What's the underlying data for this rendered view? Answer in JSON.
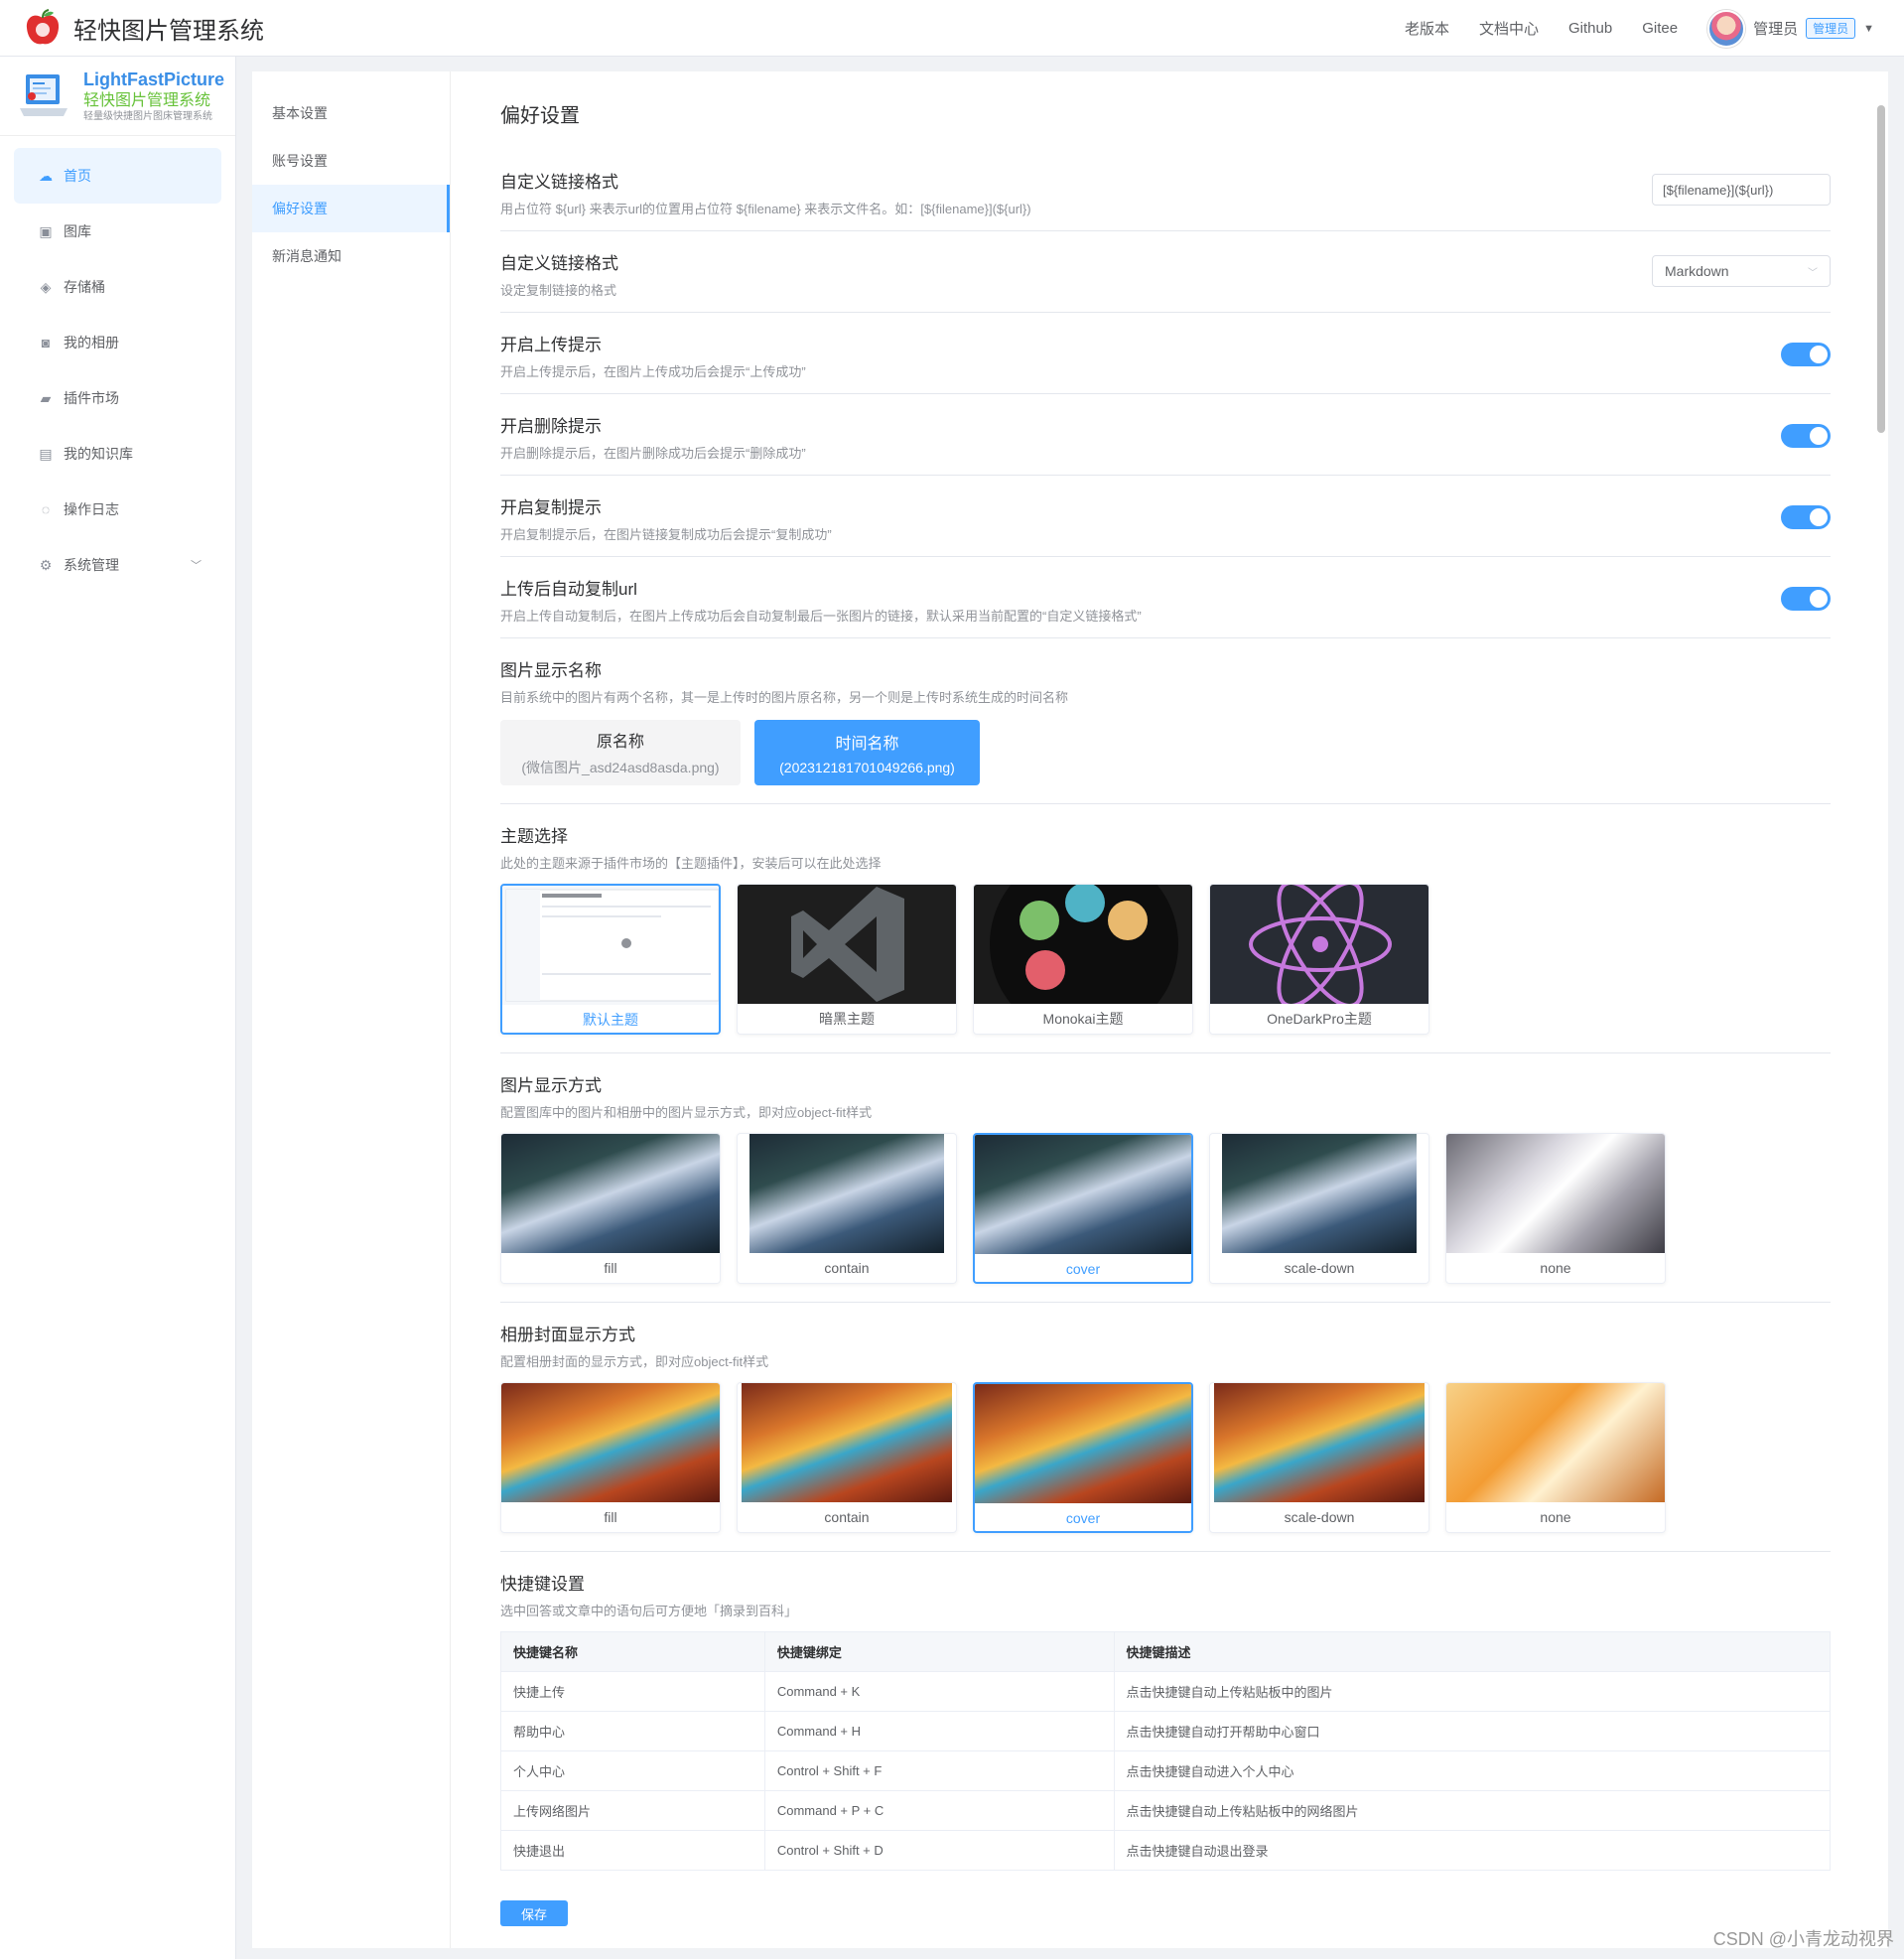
{
  "app": {
    "title": "轻快图片管理系统"
  },
  "topnav": {
    "links": [
      "老版本",
      "文档中心",
      "Github",
      "Gitee"
    ],
    "user_name": "管理员",
    "role": "管理员"
  },
  "sidebar": {
    "logo_en": "LightFastPicture",
    "logo_cn": "轻快图片管理系统",
    "logo_sub": "轻量级快捷图片图床管理系统",
    "items": [
      {
        "label": "首页",
        "icon": "cloud-icon"
      },
      {
        "label": "图库",
        "icon": "image-icon"
      },
      {
        "label": "存储桶",
        "icon": "bucket-icon"
      },
      {
        "label": "我的相册",
        "icon": "camera-icon"
      },
      {
        "label": "插件市场",
        "icon": "plugin-icon"
      },
      {
        "label": "我的知识库",
        "icon": "book-icon"
      },
      {
        "label": "操作日志",
        "icon": "chat-icon"
      },
      {
        "label": "系统管理",
        "icon": "gear-icon"
      }
    ]
  },
  "subnav": {
    "items": [
      "基本设置",
      "账号设置",
      "偏好设置",
      "新消息通知"
    ]
  },
  "page": {
    "title": "偏好设置"
  },
  "settings": {
    "link_format": {
      "title": "自定义链接格式",
      "desc": "用占位符 ${url} 来表示url的位置用占位符 ${filename} 来表示文件名。如：[${filename}](${url})",
      "value": "[${filename}](${url})"
    },
    "copy_format": {
      "title": "自定义链接格式",
      "desc": "设定复制链接的格式",
      "value": "Markdown"
    },
    "upload_tip": {
      "title": "开启上传提示",
      "desc": "开启上传提示后，在图片上传成功后会提示“上传成功”"
    },
    "delete_tip": {
      "title": "开启删除提示",
      "desc": "开启删除提示后，在图片删除成功后会提示“删除成功”"
    },
    "copy_tip": {
      "title": "开启复制提示",
      "desc": "开启复制提示后，在图片链接复制成功后会提示“复制成功”"
    },
    "auto_copy": {
      "title": "上传后自动复制url",
      "desc": "开启上传自动复制后，在图片上传成功后会自动复制最后一张图片的链接，默认采用当前配置的“自定义链接格式”"
    }
  },
  "display_name": {
    "title": "图片显示名称",
    "desc": "目前系统中的图片有两个名称，其一是上传时的图片原名称，另一个则是上传时系统生成的时间名称",
    "options": [
      {
        "title": "原名称",
        "sub": "(微信图片_asd24asd8asda.png)"
      },
      {
        "title": "时间名称",
        "sub": "(202312181701049266.png)"
      }
    ]
  },
  "theme": {
    "title": "主题选择",
    "desc": "此处的主题来源于插件市场的【主题插件】，安装后可以在此处选择",
    "options": [
      "默认主题",
      "暗黑主题",
      "Monokai主题",
      "OneDarkPro主题"
    ]
  },
  "image_fit": {
    "title": "图片显示方式",
    "desc": "配置图库中的图片和相册中的图片显示方式，即对应object-fit样式",
    "options": [
      "fill",
      "contain",
      "cover",
      "scale-down",
      "none"
    ]
  },
  "album_fit": {
    "title": "相册封面显示方式",
    "desc": "配置相册封面的显示方式，即对应object-fit样式",
    "options": [
      "fill",
      "contain",
      "cover",
      "scale-down",
      "none"
    ]
  },
  "shortcuts": {
    "title": "快捷键设置",
    "desc": "选中回答或文章中的语句后可方便地「摘录到百科」",
    "headers": [
      "快捷键名称",
      "快捷键绑定",
      "快捷键描述"
    ],
    "rows": [
      [
        "快捷上传",
        "Command + K",
        "点击快捷键自动上传粘贴板中的图片"
      ],
      [
        "帮助中心",
        "Command + H",
        "点击快捷键自动打开帮助中心窗口"
      ],
      [
        "个人中心",
        "Control + Shift + F",
        "点击快捷键自动进入个人中心"
      ],
      [
        "上传网络图片",
        "Command + P + C",
        "点击快捷键自动上传粘贴板中的网络图片"
      ],
      [
        "快捷退出",
        "Control + Shift + D",
        "点击快捷键自动退出登录"
      ]
    ]
  },
  "save_label": "保存",
  "watermark": "CSDN @小青龙动视界",
  "colors": {
    "primary": "#409eff",
    "active_bg": "#ecf5ff",
    "green": "#67c23a"
  }
}
